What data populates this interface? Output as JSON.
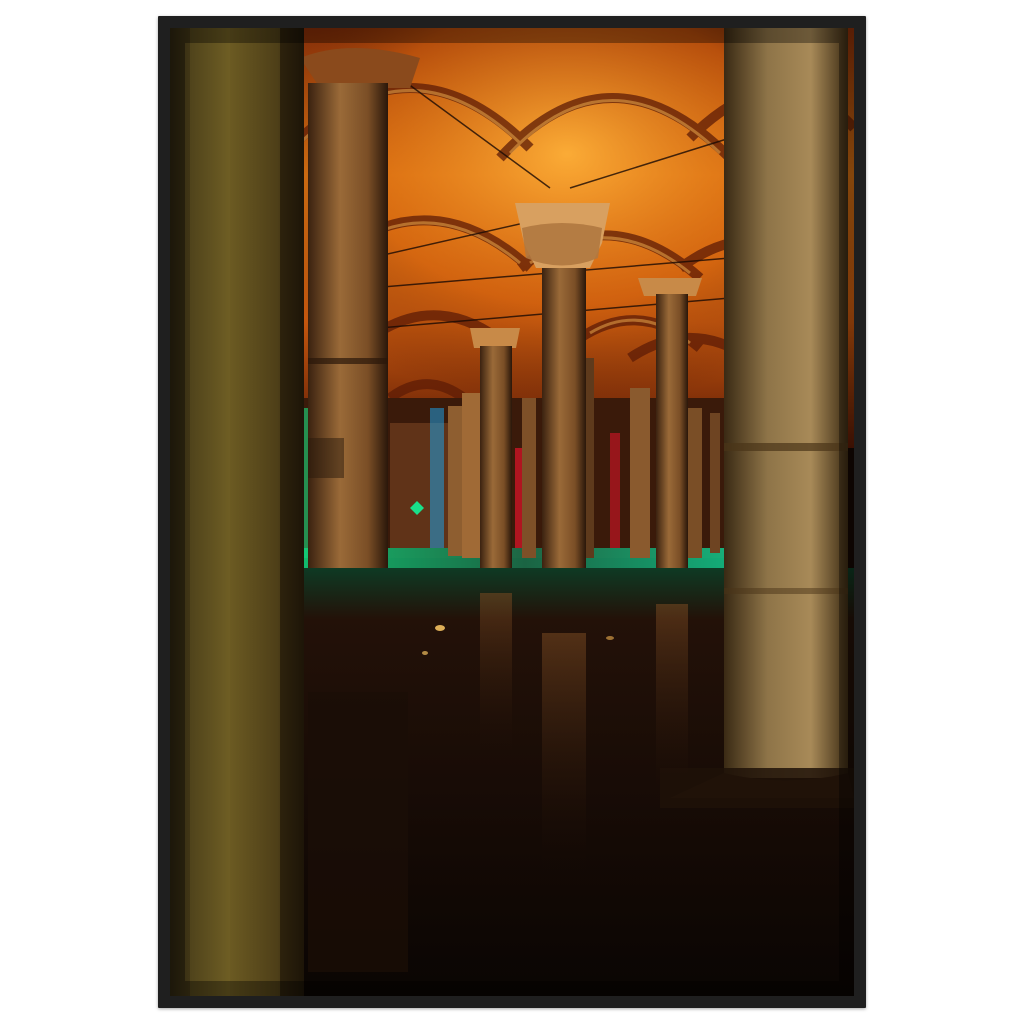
{
  "image": {
    "subject": "framed-poster",
    "description_ref": "photo-of-illuminated-underground-cistern"
  },
  "colors": {
    "wall_background": "#FFFFFF",
    "frame": "#1F1F1F",
    "vault_highlight": "#F29A1E",
    "vault_mid": "#B84E10",
    "vault_shadow": "#3A1005",
    "column_stone": "#8A5A2C",
    "column_dark": "#2E1B0E",
    "water_dark": "#120904",
    "green_light": "#19E08A",
    "teal_light": "#00C8B4",
    "blue_light": "#2A6BFF",
    "red_light": "#E3142A"
  }
}
